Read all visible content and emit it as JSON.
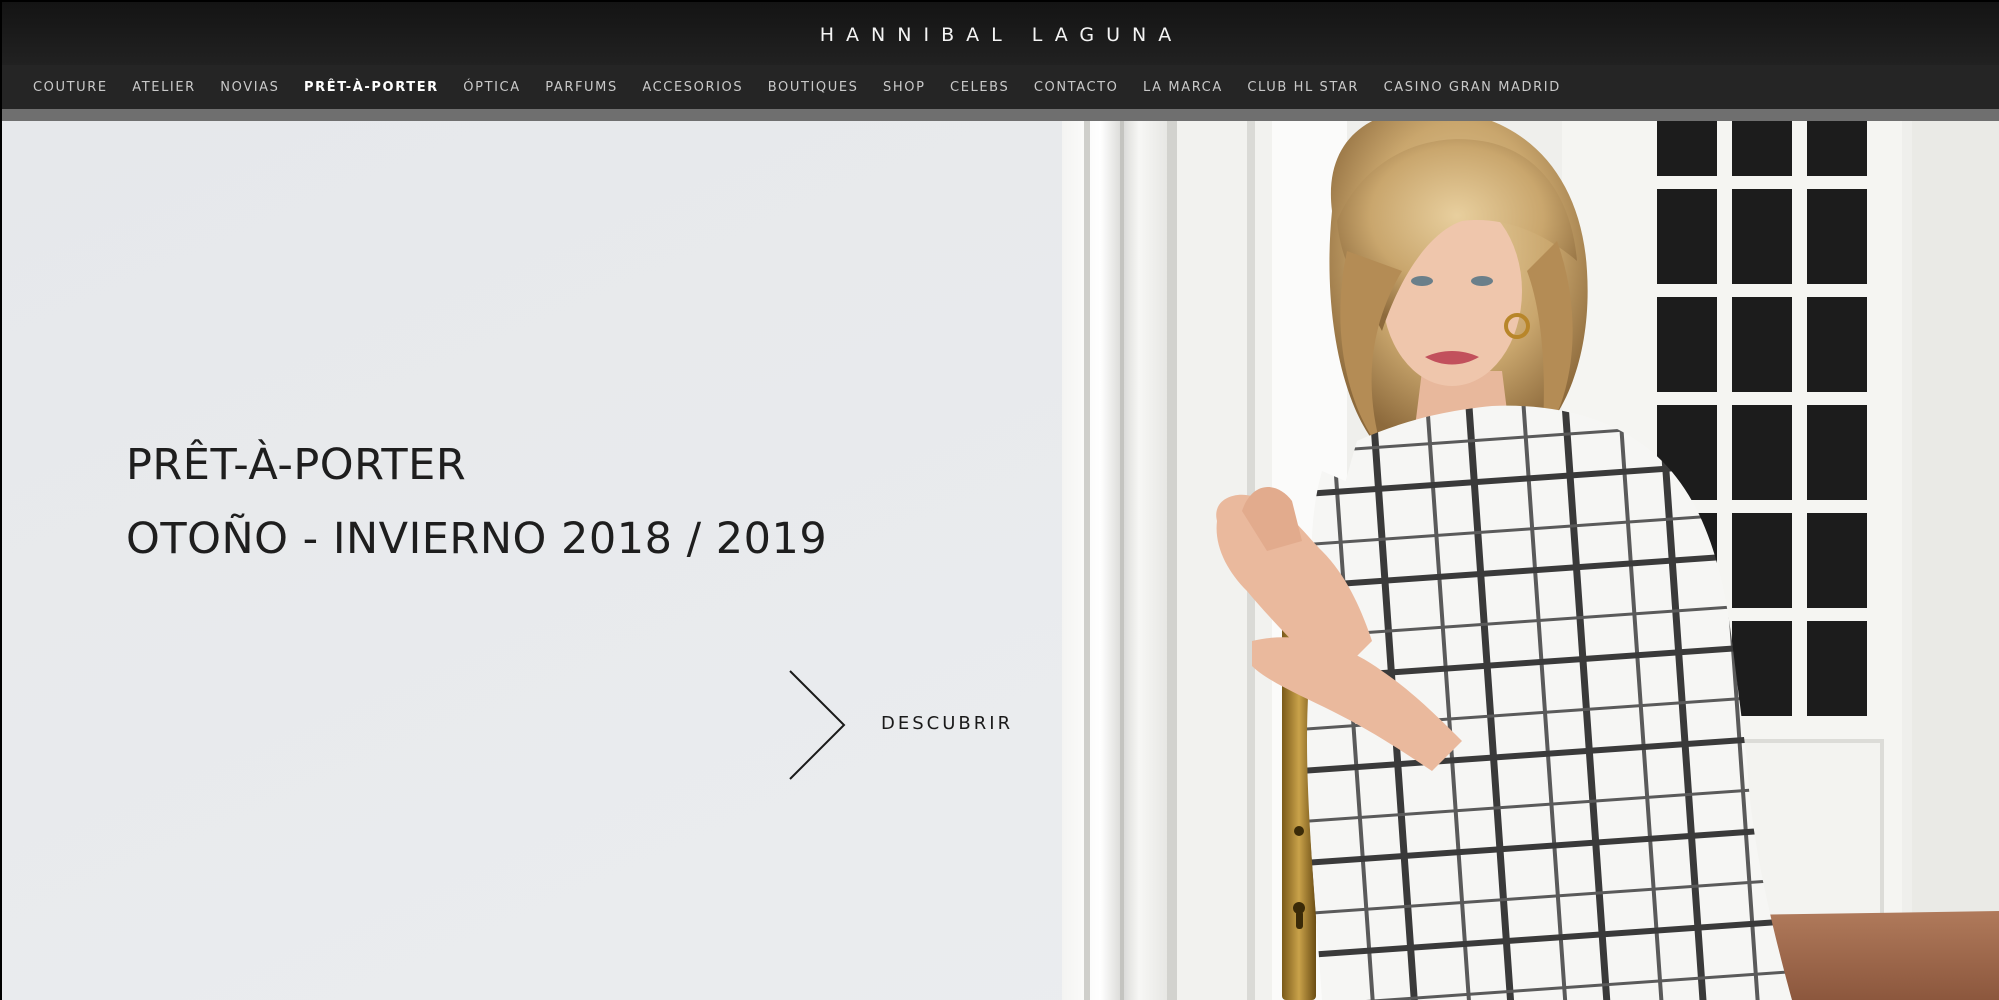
{
  "header": {
    "brand": "HANNIBAL LAGUNA"
  },
  "nav": {
    "items": [
      {
        "label": "COUTURE"
      },
      {
        "label": "ATELIER"
      },
      {
        "label": "NOVIAS"
      },
      {
        "label": "PRÊT-À-PORTER",
        "active": true
      },
      {
        "label": "ÓPTICA"
      },
      {
        "label": "PARFUMS"
      },
      {
        "label": "ACCESORIOS"
      },
      {
        "label": "BOUTIQUES"
      },
      {
        "label": "SHOP"
      },
      {
        "label": "CELEBS"
      },
      {
        "label": "CONTACTO"
      },
      {
        "label": "LA MARCA"
      },
      {
        "label": "CLUB HL STAR"
      },
      {
        "label": "CASINO GRAN MADRID"
      }
    ]
  },
  "hero": {
    "title_line1": "PRÊT-À-PORTER",
    "title_line2": "OTOÑO - INVIERNO 2018 / 2019",
    "cta_label": "DESCUBRIR",
    "cta_icon": "chevron-right-icon"
  },
  "colors": {
    "header_bg": "#1b1b1b",
    "nav_bg": "#252525",
    "nav_text": "#c9c9c9",
    "nav_active": "#ffffff",
    "hero_wall": "#e9ebee",
    "dress_check": "#3a3a3a"
  }
}
